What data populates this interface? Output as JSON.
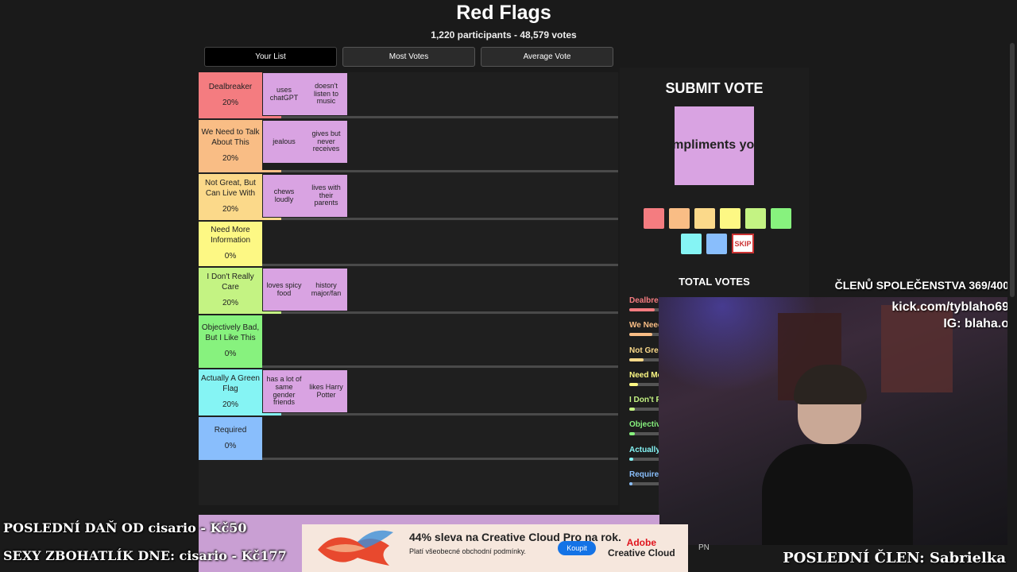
{
  "header": {
    "title": "Red Flags",
    "subtitle": "1,220 participants - 48,579 votes"
  },
  "tabs": [
    {
      "label": "Your List",
      "active": true
    },
    {
      "label": "Most Votes",
      "active": false
    },
    {
      "label": "Average Vote",
      "active": false
    }
  ],
  "tiers": [
    {
      "name": "Dealbreaker",
      "pct": "20%",
      "color": "#f47c80",
      "items": [
        "uses chatGPT",
        "doesn't listen to music"
      ]
    },
    {
      "name": "We Need to Talk About This",
      "pct": "20%",
      "color": "#f9bd85",
      "items": [
        "jealous",
        "gives but never receives"
      ]
    },
    {
      "name": "Not Great, But Can Live With",
      "pct": "20%",
      "color": "#fbd98a",
      "items": [
        "chews loudly",
        "lives with their parents"
      ]
    },
    {
      "name": "Need More Information",
      "pct": "0%",
      "color": "#fdf884",
      "items": []
    },
    {
      "name": "I Don't Really Care",
      "pct": "20%",
      "color": "#c4f383",
      "items": [
        "loves spicy food",
        "history major/fan"
      ]
    },
    {
      "name": "Objectively Bad, But I Like This",
      "pct": "0%",
      "color": "#87f27e",
      "items": []
    },
    {
      "name": "Actually A Green Flag",
      "pct": "20%",
      "color": "#85f4f4",
      "items": [
        "has a lot of same gender friends",
        "likes Harry Potter"
      ]
    },
    {
      "name": "Required",
      "pct": "0%",
      "color": "#89befc",
      "items": []
    }
  ],
  "vote": {
    "title": "SUBMIT VOTE",
    "card_text": "only compliments your body",
    "skip_label": "SKIP",
    "swatch_colors": [
      "#f47c80",
      "#f9bd85",
      "#fbd98a",
      "#fdf884",
      "#c4f383",
      "#87f27e",
      "#85f4f4",
      "#89befc"
    ]
  },
  "totals": {
    "title": "TOTAL VOTES",
    "rows": [
      {
        "label": "Dealbreaker",
        "color": "#f47c80",
        "fill": 0.18
      },
      {
        "label": "We Need to Talk About This",
        "color": "#f9bd85",
        "fill": 0.16
      },
      {
        "label": "Not Great, But Can Live With",
        "color": "#fbd98a",
        "fill": 0.1
      },
      {
        "label": "Need More Information",
        "color": "#fdf884",
        "fill": 0.06
      },
      {
        "label": "I Don't Really Care",
        "color": "#c4f383",
        "fill": 0.04
      },
      {
        "label": "Objectively Bad, But I Like This",
        "color": "#87f27e",
        "fill": 0.04
      },
      {
        "label": "Actually A Green Flag",
        "color": "#85f4f4",
        "fill": 0.03
      },
      {
        "label": "Required",
        "color": "#89befc",
        "fill": 0.02
      }
    ]
  },
  "stream": {
    "members": "ČLENŮ SPOLEČENSTVA 369/400",
    "kick": "kick.com/tyblaho69",
    "ig": "IG: blaha.o",
    "last_tax": "POSLEDNÍ DAŇ OD cisario - Kč50",
    "sexy": "SEXY ZBOHATLÍK DNE: cisario - Kč177",
    "last_member": "POSLEDNÍ ČLEN: Sabrielka",
    "pn": "PN"
  },
  "ad": {
    "headline": "44% sleva na Creative Cloud Pro na rok.",
    "fine_print": "Platí všeobecné obchodní podmínky.",
    "button": "Koupit",
    "brand_top": "Adobe",
    "brand_bottom": "Creative Cloud"
  }
}
